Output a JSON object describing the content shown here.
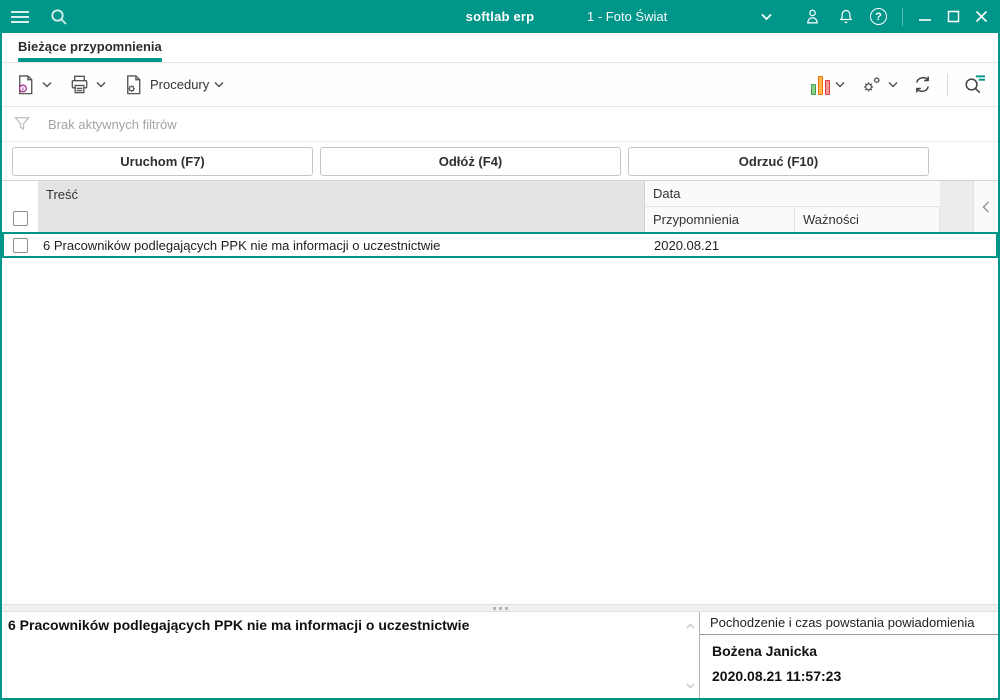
{
  "colors": {
    "accent_teal": "#00968a",
    "bar_green": "#43a047",
    "bar_orange": "#ef6c00",
    "bar_red": "#e53935"
  },
  "titlebar": {
    "app_title": "softlab erp",
    "company": "1 - Foto Świat"
  },
  "tabs": [
    {
      "label": "Bieżące przypomnienia"
    }
  ],
  "toolbar": {
    "procedures_label": "Procedury"
  },
  "filterbar": {
    "status_text": "Brak aktywnych filtrów"
  },
  "actions": {
    "run_label": "Uruchom (F7)",
    "postpone_label": "Odłóż (F4)",
    "reject_label": "Odrzuć (F10)"
  },
  "table": {
    "columns": {
      "content": "Treść",
      "date_group": "Data",
      "reminder": "Przypomnienia",
      "validity": "Ważności"
    },
    "rows": [
      {
        "content": "6 Pracowników podlegających PPK nie ma informacji o uczestnictwie",
        "reminder_date": "2020.08.21",
        "validity_date": ""
      }
    ]
  },
  "details": {
    "message": "6 Pracowników podlegających PPK nie ma informacji o uczestnictwie",
    "origin_title": "Pochodzenie i czas powstania powiadomienia",
    "author": "Bożena Janicka",
    "created_at": "2020.08.21 11:57:23"
  },
  "icons": {
    "help_glyph": "?"
  }
}
